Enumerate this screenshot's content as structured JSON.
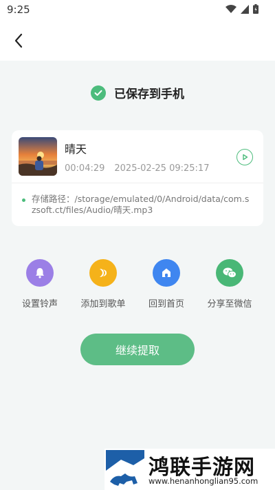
{
  "status_bar": {
    "time": "9:25"
  },
  "header": {
    "back_icon": "chevron-left-icon"
  },
  "saved": {
    "text": "已保存到手机",
    "icon": "check-circle-icon",
    "color": "#4cbc7c"
  },
  "track": {
    "title": "晴天",
    "duration": "00:04:29",
    "datetime": "2025-02-25 09:25:17",
    "path_label": "存储路径：",
    "path": "/storage/emulated/0/Android/data/com.szsoft.ct/files/Audio/晴天.mp3"
  },
  "actions": [
    {
      "label": "设置铃声",
      "icon": "bell-icon",
      "color": "#9b7fe6"
    },
    {
      "label": "添加到歌单",
      "icon": "music-add-icon",
      "color": "#f5b21a"
    },
    {
      "label": "回到首页",
      "icon": "home-icon",
      "color": "#3f86f0"
    },
    {
      "label": "分享至微信",
      "icon": "wechat-icon",
      "color": "#49b776"
    }
  ],
  "continue_button": {
    "label": "继续提取"
  },
  "watermark": {
    "title": "鸿联手游网",
    "url": "www.henanhonglian95.com"
  }
}
